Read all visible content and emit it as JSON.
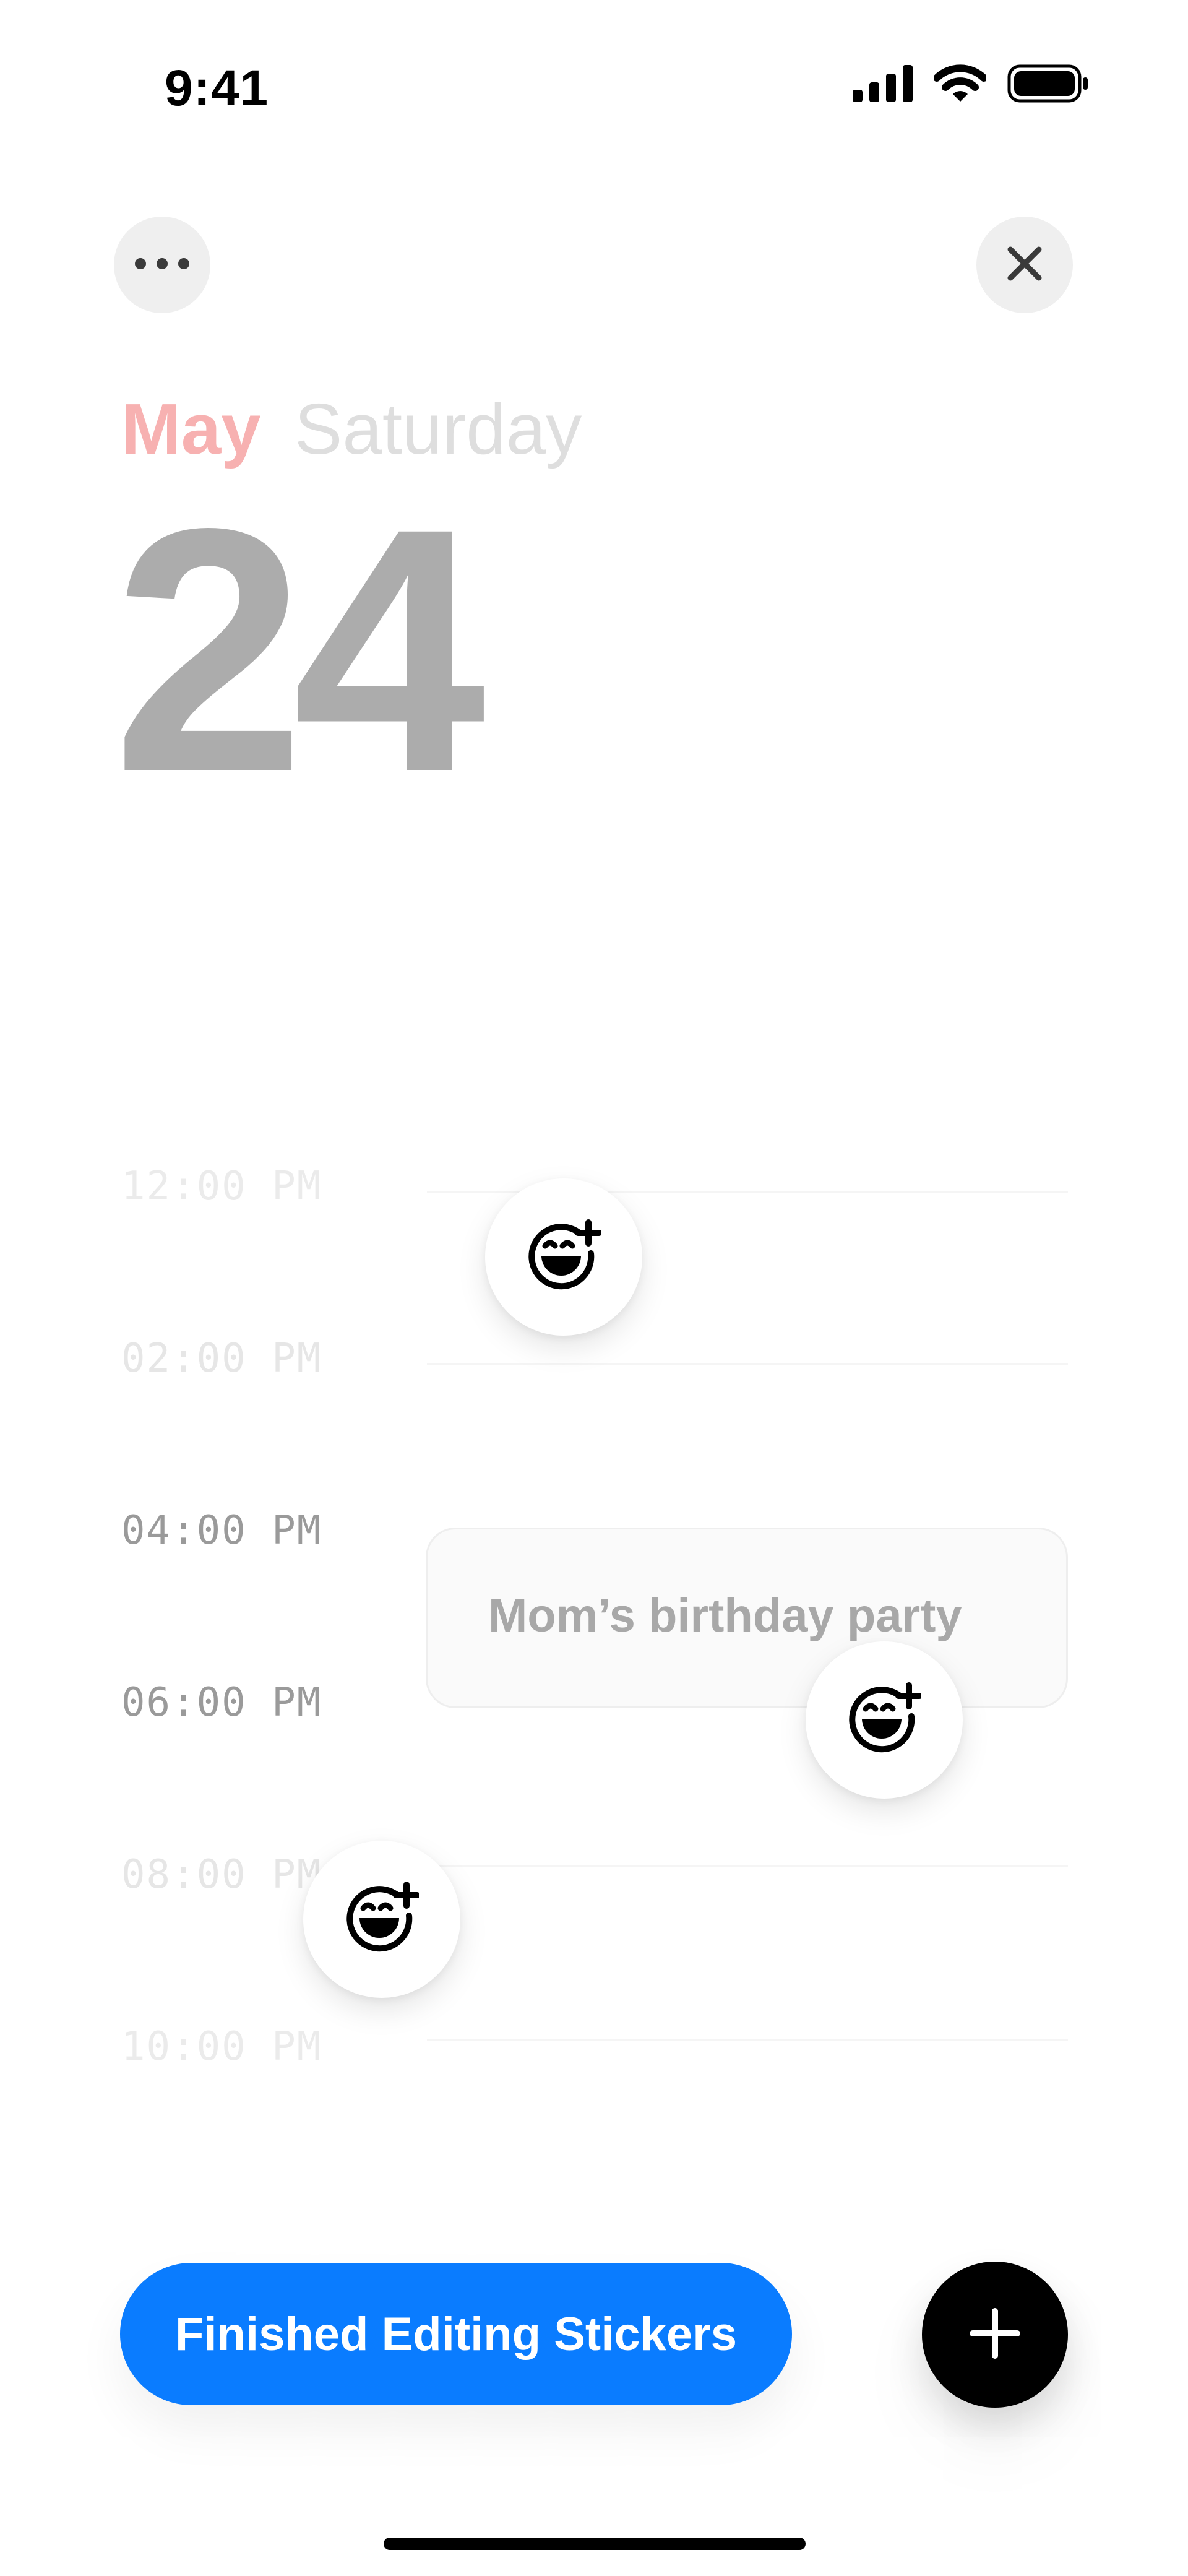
{
  "status_bar": {
    "time": "9:41",
    "icons": [
      "signal-icon",
      "wifi-icon",
      "battery-icon"
    ]
  },
  "header": {
    "more_icon": "ellipsis-icon",
    "close_icon": "close-icon",
    "month": "May",
    "weekday": "Saturday",
    "day": "24"
  },
  "timeline": {
    "labels": [
      "12:00 PM",
      "02:00 PM",
      "04:00 PM",
      "06:00 PM",
      "08:00 PM",
      "10:00 PM"
    ]
  },
  "event": {
    "title": "Mom’s birthday party"
  },
  "stickers": [
    "add-sticker-icon",
    "add-sticker-icon",
    "add-sticker-icon"
  ],
  "footer": {
    "finish_label": "Finished Editing Stickers",
    "add_icon": "plus-icon"
  },
  "colors": {
    "accent_blue": "#0a7cff",
    "month_pink": "#f7b1b1",
    "day_gray": "#acacac",
    "add_button": "#000000"
  }
}
